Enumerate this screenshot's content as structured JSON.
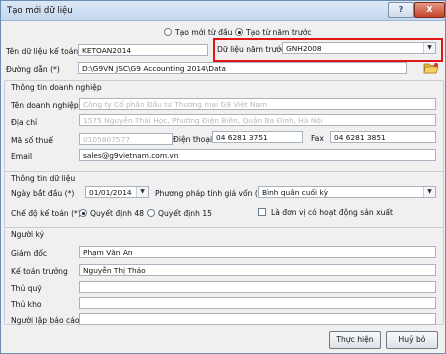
{
  "window": {
    "title": "Tạo mới dữ liệu",
    "help": "?",
    "close": "X"
  },
  "mode": {
    "new_label": "Tạo mới từ đầu",
    "from_prev_label": "Tạo từ năm trước",
    "selected": "from_prev"
  },
  "data_name": {
    "label": "Tên dữ liệu kế toán",
    "value": "KETOAN2014"
  },
  "prev_year": {
    "label": "Dữ liệu năm trước",
    "value": "GNH2008"
  },
  "path": {
    "label": "Đường dẫn (*)",
    "value": "D:\\G9VN JSC\\G9 Accounting 2014\\Data"
  },
  "company": {
    "title": "Thông tin doanh nghiệp",
    "name_label": "Tên doanh nghiệp",
    "name_value": "Công ty Cổ phần Đầu tư Thương mại G9 Việt Nam",
    "address_label": "Địa chỉ",
    "address_value": "1575 Nguyễn Thái Học, Phường Điện Biên, Quận Ba Đình, Hà Nội",
    "tax_label": "Mã số thuế",
    "tax_value": "0105807577",
    "phone_label": "Điện thoại",
    "phone_value": "04 6281 3751",
    "fax_label": "Fax",
    "fax_value": "04 6281 3851",
    "email_label": "Email",
    "email_value": "sales@g9vietnam.com.vn"
  },
  "data_info": {
    "title": "Thông tin dữ liệu",
    "start_label": "Ngày bắt đầu (*)",
    "start_value": "01/01/2014",
    "method_label": "Phương pháp tính giá vốn (*)",
    "method_value": "Bình quân cuối kỳ",
    "regime_label": "Chế độ kế toán (*)",
    "regime_48": "Quyết định 48",
    "regime_15": "Quyết định 15",
    "regime_selected": "48",
    "production_label": "Là đơn vị có hoạt động sản xuất"
  },
  "signers": {
    "title": "Người ký",
    "director_label": "Giám đốc",
    "director_value": "Phạm Văn An",
    "accountant_label": "Kế toán trưởng",
    "accountant_value": "Nguyễn Thị Thảo",
    "cashier_label": "Thủ quỹ",
    "cashier_value": "",
    "storekeeper_label": "Thủ kho",
    "storekeeper_value": "",
    "preparer_label": "Người lập báo cáo",
    "preparer_value": ""
  },
  "buttons": {
    "execute": "Thực hiện",
    "cancel": "Huỷ bỏ"
  },
  "colors": {
    "highlight": "#e01515",
    "titlebar": "#c4d7ee",
    "close": "#c4442a"
  },
  "icons": {
    "folder": "folder-icon",
    "dropdown": "chevron-down-icon"
  }
}
